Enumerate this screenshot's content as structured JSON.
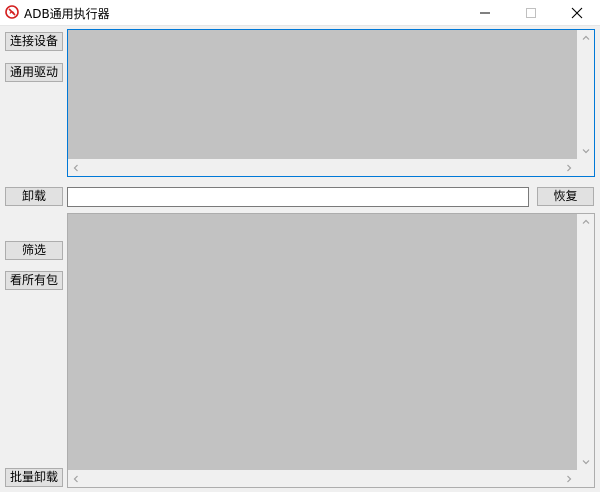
{
  "window": {
    "title": "ADB通用执行器"
  },
  "buttons": {
    "connect": "连接设备",
    "driver": "通用驱动",
    "uninstall": "卸载",
    "restore": "恢复",
    "filter": "筛选",
    "all_packages": "看所有包",
    "batch_uninstall": "批量卸载"
  },
  "package_input": {
    "value": ""
  },
  "icons": {
    "app": "adb-app-icon",
    "minimize": "minimize-icon",
    "maximize": "maximize-icon",
    "close": "close-icon"
  }
}
